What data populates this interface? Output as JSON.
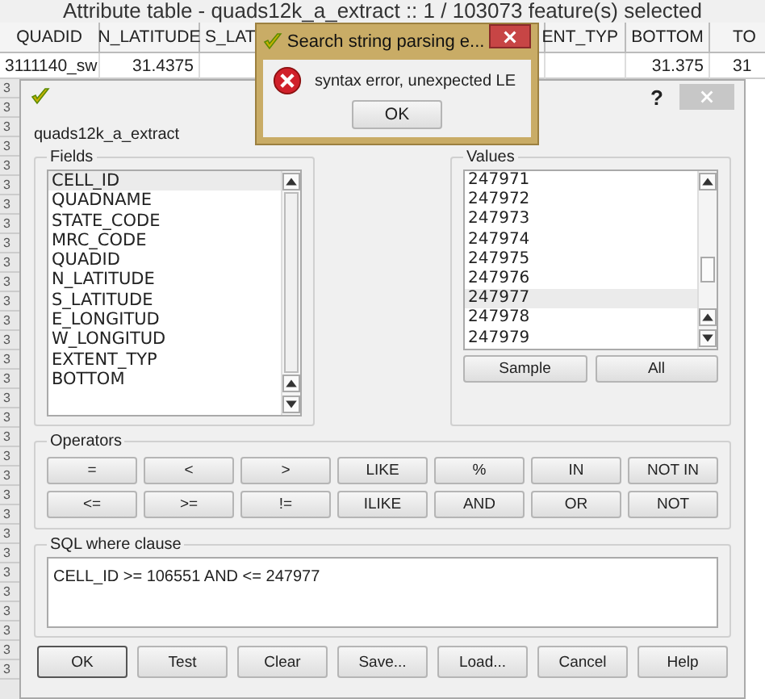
{
  "window": {
    "title": "Attribute table - quads12k_a_extract :: 1 / 103073 feature(s) selected"
  },
  "table": {
    "columns": [
      "QUADID",
      "N_LATITUDE",
      "S_LAT",
      "ENT_TYP",
      "BOTTOM",
      "TO"
    ],
    "rows": [
      [
        "3111140_sw",
        "31.4375",
        "",
        "",
        "31.375",
        "31"
      ]
    ],
    "row_numbers": [
      "3",
      "3",
      "3",
      "3",
      "3",
      "3",
      "3",
      "3",
      "3",
      "3",
      "3",
      "3",
      "3",
      "3",
      "3",
      "3",
      "3",
      "3",
      "3",
      "3",
      "3",
      "3",
      "3",
      "3",
      "3",
      "3",
      "3",
      "3",
      "3",
      "3",
      "3"
    ]
  },
  "dialog": {
    "help": "?",
    "layer": "quads12k_a_extract",
    "fields": {
      "title": "Fields",
      "items": [
        {
          "label": "CELL_ID",
          "selected": true
        },
        {
          "label": "QUADNAME",
          "selected": false
        },
        {
          "label": "STATE_CODE",
          "selected": false
        },
        {
          "label": "MRC_CODE",
          "selected": false
        },
        {
          "label": "QUADID",
          "selected": false
        },
        {
          "label": "N_LATITUDE",
          "selected": false
        },
        {
          "label": "S_LATITUDE",
          "selected": false
        },
        {
          "label": "E_LONGITUD",
          "selected": false
        },
        {
          "label": "W_LONGITUD",
          "selected": false
        },
        {
          "label": "EXTENT_TYP",
          "selected": false
        },
        {
          "label": "BOTTOM",
          "selected": false
        }
      ]
    },
    "values": {
      "title": "Values",
      "items": [
        {
          "label": "247971",
          "selected": false
        },
        {
          "label": "247972",
          "selected": false
        },
        {
          "label": "247973",
          "selected": false
        },
        {
          "label": "247974",
          "selected": false
        },
        {
          "label": "247975",
          "selected": false
        },
        {
          "label": "247976",
          "selected": false
        },
        {
          "label": "247977",
          "selected": true
        },
        {
          "label": "247978",
          "selected": false
        },
        {
          "label": "247979",
          "selected": false
        }
      ],
      "buttons": [
        "Sample",
        "All"
      ]
    },
    "operators": {
      "title": "Operators",
      "buttons": [
        "=",
        "<",
        ">",
        "LIKE",
        "%",
        "IN",
        "NOT IN",
        "<=",
        ">=",
        "!=",
        "ILIKE",
        "AND",
        "OR",
        "NOT"
      ]
    },
    "sql": {
      "title": "SQL where clause",
      "value": "CELL_ID >=  106551 AND  <= 247977"
    },
    "buttons": [
      {
        "label": "OK",
        "default": true
      },
      {
        "label": "Test",
        "default": false
      },
      {
        "label": "Clear",
        "default": false
      },
      {
        "label": "Save...",
        "default": false
      },
      {
        "label": "Load...",
        "default": false
      },
      {
        "label": "Cancel",
        "default": false
      },
      {
        "label": "Help",
        "default": false
      }
    ]
  },
  "error": {
    "title": "Search string parsing e...",
    "message": "syntax error, unexpected LE",
    "button": "OK"
  }
}
